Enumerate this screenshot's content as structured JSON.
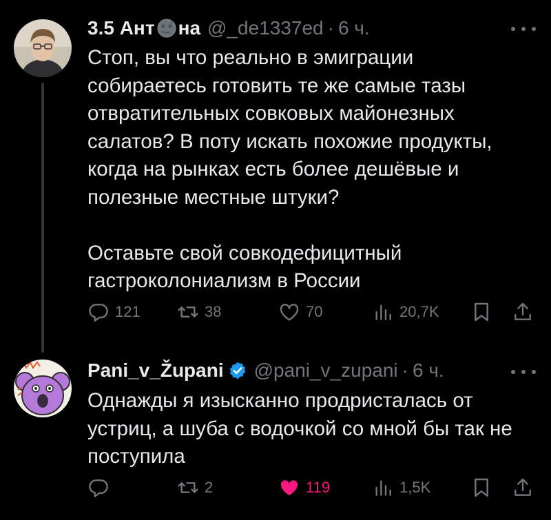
{
  "tweets": [
    {
      "name_part1": "3.5 Ант",
      "name_part2": "на",
      "handle": "@_de1337ed",
      "separator": "·",
      "time": "6 ч.",
      "text": "Стоп, вы что реально в эмиграции собираетесь готовить те же самые тазы отвратительных совковых майонезных салатов? В поту искать похожие продукты, когда на рынках есть более дешёвые и полезные местные штуки?\n\nОставьте свой совкодефицитный гастроколониализм в России",
      "replies": "121",
      "reposts": "38",
      "likes": "70",
      "views": "20,7K"
    },
    {
      "name": "Pani_v_Župani",
      "handle": "@pani_v_zupani",
      "separator": "·",
      "time": "6 ч.",
      "text": "Однажды я изысканно продристалась от устриц, а шуба с водочкой со мной бы так не поступила",
      "replies": "",
      "reposts": "2",
      "likes": "119",
      "views": "1,5K"
    }
  ],
  "colors": {
    "background": "#000000",
    "text": "#e7e9ea",
    "secondary": "#71767b",
    "like_active": "#f91880",
    "verified": "#1d9bf0",
    "thread_line": "#333639"
  }
}
